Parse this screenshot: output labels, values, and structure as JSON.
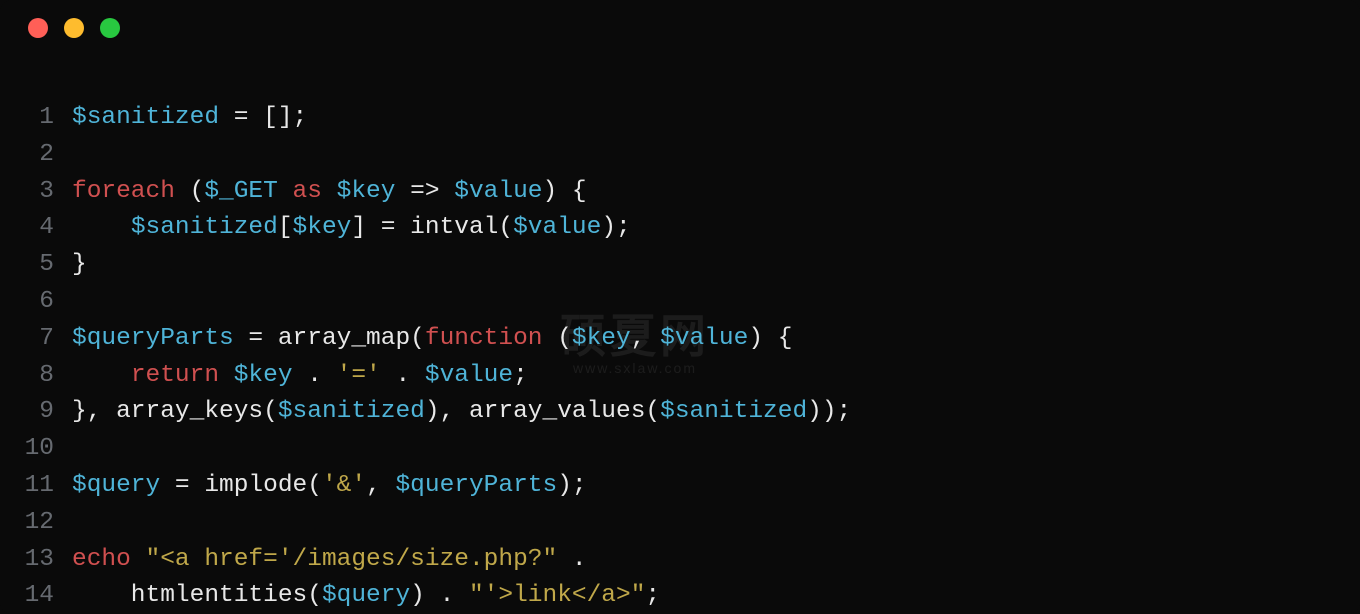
{
  "traffic_lights": {
    "close": "#ff5f57",
    "minimize": "#febc2e",
    "zoom": "#28c840"
  },
  "watermark": {
    "main": "硕夏网",
    "sub": "www.sxlaw.com"
  },
  "code": {
    "lines": [
      {
        "n": "1",
        "tokens": [
          {
            "t": "$sanitized",
            "c": "tok-var"
          },
          {
            "t": " = [];",
            "c": "tok-punct"
          }
        ]
      },
      {
        "n": "2",
        "tokens": []
      },
      {
        "n": "3",
        "tokens": [
          {
            "t": "foreach",
            "c": "tok-kw"
          },
          {
            "t": " (",
            "c": "tok-punct"
          },
          {
            "t": "$_GET",
            "c": "tok-var"
          },
          {
            "t": " ",
            "c": "tok-plain"
          },
          {
            "t": "as",
            "c": "tok-kw"
          },
          {
            "t": " ",
            "c": "tok-plain"
          },
          {
            "t": "$key",
            "c": "tok-var"
          },
          {
            "t": " => ",
            "c": "tok-punct"
          },
          {
            "t": "$value",
            "c": "tok-var"
          },
          {
            "t": ") {",
            "c": "tok-punct"
          }
        ]
      },
      {
        "n": "4",
        "tokens": [
          {
            "t": "    ",
            "c": "tok-plain"
          },
          {
            "t": "$sanitized",
            "c": "tok-var"
          },
          {
            "t": "[",
            "c": "tok-punct"
          },
          {
            "t": "$key",
            "c": "tok-var"
          },
          {
            "t": "] = intval(",
            "c": "tok-punct"
          },
          {
            "t": "$value",
            "c": "tok-var"
          },
          {
            "t": ");",
            "c": "tok-punct"
          }
        ]
      },
      {
        "n": "5",
        "tokens": [
          {
            "t": "}",
            "c": "tok-punct"
          }
        ]
      },
      {
        "n": "6",
        "tokens": []
      },
      {
        "n": "7",
        "tokens": [
          {
            "t": "$queryParts",
            "c": "tok-var"
          },
          {
            "t": " = array_map(",
            "c": "tok-punct"
          },
          {
            "t": "function",
            "c": "tok-kw"
          },
          {
            "t": " (",
            "c": "tok-punct"
          },
          {
            "t": "$key",
            "c": "tok-var"
          },
          {
            "t": ", ",
            "c": "tok-punct"
          },
          {
            "t": "$value",
            "c": "tok-var"
          },
          {
            "t": ") {",
            "c": "tok-punct"
          }
        ]
      },
      {
        "n": "8",
        "tokens": [
          {
            "t": "    ",
            "c": "tok-plain"
          },
          {
            "t": "return",
            "c": "tok-kw"
          },
          {
            "t": " ",
            "c": "tok-plain"
          },
          {
            "t": "$key",
            "c": "tok-var"
          },
          {
            "t": " . ",
            "c": "tok-punct"
          },
          {
            "t": "'='",
            "c": "tok-str"
          },
          {
            "t": " . ",
            "c": "tok-punct"
          },
          {
            "t": "$value",
            "c": "tok-var"
          },
          {
            "t": ";",
            "c": "tok-punct"
          }
        ]
      },
      {
        "n": "9",
        "tokens": [
          {
            "t": "}, array_keys(",
            "c": "tok-punct"
          },
          {
            "t": "$sanitized",
            "c": "tok-var"
          },
          {
            "t": "), array_values(",
            "c": "tok-punct"
          },
          {
            "t": "$sanitized",
            "c": "tok-var"
          },
          {
            "t": "));",
            "c": "tok-punct"
          }
        ]
      },
      {
        "n": "10",
        "tokens": []
      },
      {
        "n": "11",
        "tokens": [
          {
            "t": "$query",
            "c": "tok-var"
          },
          {
            "t": " = implode(",
            "c": "tok-punct"
          },
          {
            "t": "'&'",
            "c": "tok-str"
          },
          {
            "t": ", ",
            "c": "tok-punct"
          },
          {
            "t": "$queryParts",
            "c": "tok-var"
          },
          {
            "t": ");",
            "c": "tok-punct"
          }
        ]
      },
      {
        "n": "12",
        "tokens": []
      },
      {
        "n": "13",
        "tokens": [
          {
            "t": "echo",
            "c": "tok-kw"
          },
          {
            "t": " ",
            "c": "tok-plain"
          },
          {
            "t": "\"<a href='/images/size.php?\"",
            "c": "tok-str"
          },
          {
            "t": " .",
            "c": "tok-punct"
          }
        ]
      },
      {
        "n": "14",
        "tokens": [
          {
            "t": "    htmlentities(",
            "c": "tok-punct"
          },
          {
            "t": "$query",
            "c": "tok-var"
          },
          {
            "t": ") . ",
            "c": "tok-punct"
          },
          {
            "t": "\"'>link</a>\"",
            "c": "tok-str"
          },
          {
            "t": ";",
            "c": "tok-punct"
          }
        ]
      }
    ]
  }
}
